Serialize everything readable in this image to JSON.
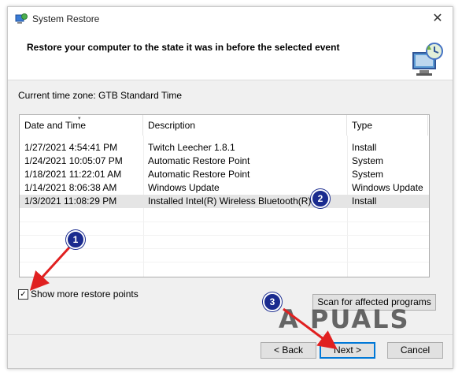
{
  "window": {
    "title": "System Restore"
  },
  "header": {
    "title": "Restore your computer to the state it was in before the selected event"
  },
  "timezone": {
    "label": "Current time zone: GTB Standard Time"
  },
  "table": {
    "columns": [
      "Date and Time",
      "Description",
      "Type"
    ],
    "rows": [
      {
        "date": "1/27/2021 4:54:41 PM",
        "description": "Twitch Leecher 1.8.1",
        "type": "Install"
      },
      {
        "date": "1/24/2021 10:05:07 PM",
        "description": "Automatic Restore Point",
        "type": "System"
      },
      {
        "date": "1/18/2021 11:22:01 AM",
        "description": "Automatic Restore Point",
        "type": "System"
      },
      {
        "date": "1/14/2021 8:06:38 AM",
        "description": "Windows Update",
        "type": "Windows Update"
      },
      {
        "date": "1/3/2021 11:08:29 PM",
        "description": "Installed Intel(R) Wireless Bluetooth(R)",
        "type": "Install"
      }
    ],
    "selected_row": 4
  },
  "options": {
    "show_more_label": "Show more restore points",
    "show_more_checked": true
  },
  "buttons": {
    "scan": "Scan for affected programs",
    "back": "< Back",
    "next": "Next >",
    "cancel": "Cancel"
  },
  "annotations": {
    "step1": "1",
    "step2": "2",
    "step3": "3",
    "arrow_color": "#e02020",
    "badge_color": "#1a2b8f"
  },
  "watermark": {
    "text": "A PUALS"
  },
  "icons": {
    "title": "system-restore-icon",
    "header": "restore-computer-icon",
    "close": "close-icon",
    "check": "checkmark-icon"
  }
}
